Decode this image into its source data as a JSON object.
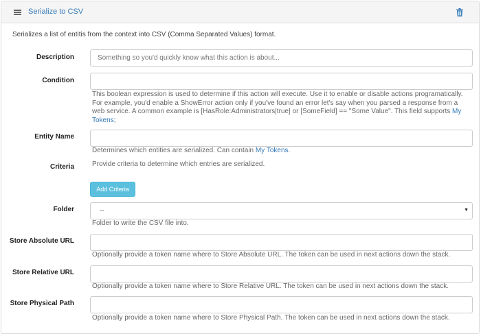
{
  "header": {
    "title": "Serialize to CSV",
    "menu_icon": "hamburger-menu-icon",
    "delete_icon": "trash-icon"
  },
  "intro": "Serializes a list of entitis from the context into CSV (Comma Separated Values) format.",
  "fields": {
    "description": {
      "label": "Description",
      "value": "",
      "placeholder": "Something so you'd quickly know what this action is about..."
    },
    "condition": {
      "label": "Condition",
      "value": "",
      "help": "This boolean expression is used to determine if this action will execute. Use it to enable or disable actions programatically. For example, you'd enable a ShowError action only if you've found an error let's say when you parsed a response from a web service. A common example is [HasRole:Administrators|true] or [SomeField] == \"Some Value\". This field supports ",
      "help_link": "My Tokens",
      "help_suffix": ";"
    },
    "entity_name": {
      "label": "Entity Name",
      "value": "",
      "help": "Determines which entities are serialized. Can contain ",
      "help_link": "My Tokens",
      "help_suffix": "."
    },
    "criteria": {
      "label": "Criteria",
      "help": "Provide criteria to determine which entries are serialized.",
      "button": "Add Criteria"
    },
    "folder": {
      "label": "Folder",
      "selected": "--",
      "help": "Folder to write the CSV file into."
    },
    "store_absolute_url": {
      "label": "Store Absolute URL",
      "value": "",
      "help": "Optionally provide a token name where to Store Absolute URL. The token can be used in next actions down the stack."
    },
    "store_relative_url": {
      "label": "Store Relative URL",
      "value": "",
      "help": "Optionally provide a token name where to Store Relative URL. The token can be used in next actions down the stack."
    },
    "store_physical_path": {
      "label": "Store Physical Path",
      "value": "",
      "help": "Optionally provide a token name where to Store Physical Path. The token can be used in next actions down the stack."
    }
  },
  "colors": {
    "link": "#337ab7",
    "button_info": "#5bc0de",
    "header_bg": "#f5f5f5",
    "border": "#cccccc"
  }
}
